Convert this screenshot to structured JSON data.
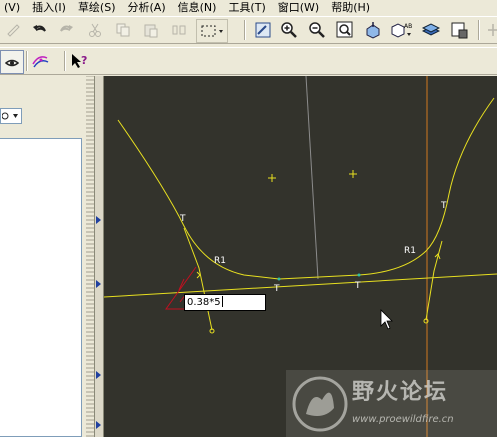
{
  "menubar": {
    "items": [
      {
        "label": "(V)"
      },
      {
        "label": "插入(I)"
      },
      {
        "label": "草绘(S)"
      },
      {
        "label": "分析(A)"
      },
      {
        "label": "信息(N)"
      },
      {
        "label": "工具(T)"
      },
      {
        "label": "窗口(W)"
      },
      {
        "label": "帮助(H)"
      }
    ]
  },
  "sketch": {
    "dimension_input_value": "0.38*5",
    "labels": {
      "tangent": "T",
      "radius": "R1"
    }
  },
  "colors": {
    "canvas_background": "#33332c",
    "sketch_entity": "#e8e020",
    "centerline": "#d07820",
    "dimension": "#c01020"
  },
  "watermark": {
    "title": "野火论坛",
    "url": "www.proewildfire.cn"
  }
}
